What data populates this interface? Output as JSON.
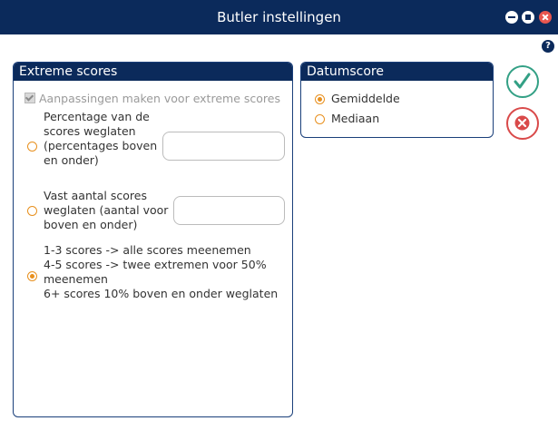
{
  "window": {
    "title": "Butler instellingen",
    "help_icon": "?"
  },
  "extreme_scores": {
    "header": "Extreme scores",
    "checkbox_label": "Aanpassingen maken voor extreme scores",
    "checkbox_checked": true,
    "options": [
      {
        "lines": [
          "Percentage van de",
          "scores weglaten",
          "(percentages boven",
          "en onder)"
        ],
        "selected": false,
        "input_value": ""
      },
      {
        "lines": [
          "Vast aantal scores",
          "weglaten (aantal voor",
          "boven en onder)"
        ],
        "selected": false,
        "input_value": ""
      },
      {
        "lines": [
          "1-3 scores -> alle scores meenemen",
          "4-5 scores -> twee extremen voor 50%",
          "meenemen",
          "6+ scores 10% boven en onder weglaten"
        ],
        "selected": true
      }
    ]
  },
  "datumscore": {
    "header": "Datumscore",
    "options": [
      {
        "label": "Gemiddelde",
        "selected": true
      },
      {
        "label": "Mediaan",
        "selected": false
      }
    ]
  },
  "colors": {
    "titlebar": "#0b2a5b",
    "accent_radio": "#e8901e",
    "ok": "#33a085",
    "cancel": "#d94a4a"
  }
}
